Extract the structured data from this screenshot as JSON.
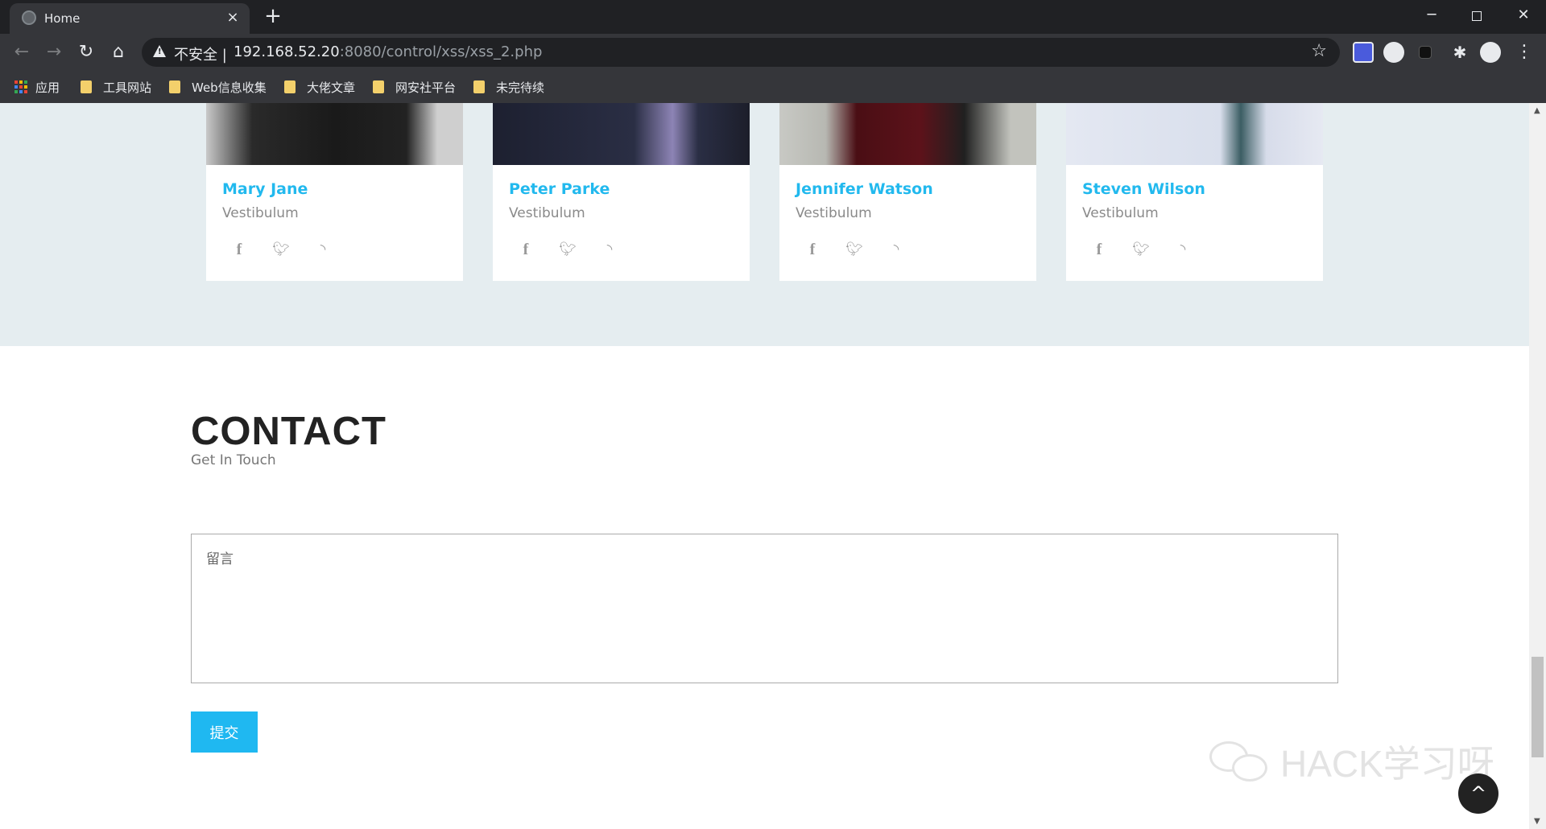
{
  "browser": {
    "tab_title": "Home",
    "tab_close": "×",
    "new_tab": "+",
    "security_label": "不安全 |",
    "url_host": "192.168.52.20",
    "url_path": ":8080/control/xss/xss_2.php",
    "bookmarks": [
      {
        "label": "应用",
        "icon": "apps-grid-icon"
      },
      {
        "label": "工具网站",
        "icon": "folder-icon"
      },
      {
        "label": "Web信息收集",
        "icon": "folder-icon"
      },
      {
        "label": "大佬文章",
        "icon": "folder-icon"
      },
      {
        "label": "网安社平台",
        "icon": "folder-icon"
      },
      {
        "label": "未完待续",
        "icon": "folder-icon"
      }
    ]
  },
  "team": {
    "members": [
      {
        "name": "Mary Jane",
        "role": "Vestibulum"
      },
      {
        "name": "Peter Parke",
        "role": "Vestibulum"
      },
      {
        "name": "Jennifer Watson",
        "role": "Vestibulum"
      },
      {
        "name": "Steven Wilson",
        "role": "Vestibulum"
      }
    ],
    "social_icons": [
      "facebook-icon",
      "twitter-icon",
      "rss-icon"
    ]
  },
  "contact": {
    "title": "CONTACT",
    "subtitle": "Get In Touch",
    "message_placeholder": "留言",
    "submit_label": "提交"
  },
  "watermark": {
    "text": "HACK学习呀"
  },
  "colors": {
    "accent": "#22b9ee",
    "team_bg": "#e5edf0",
    "button": "#1fb8f1"
  }
}
